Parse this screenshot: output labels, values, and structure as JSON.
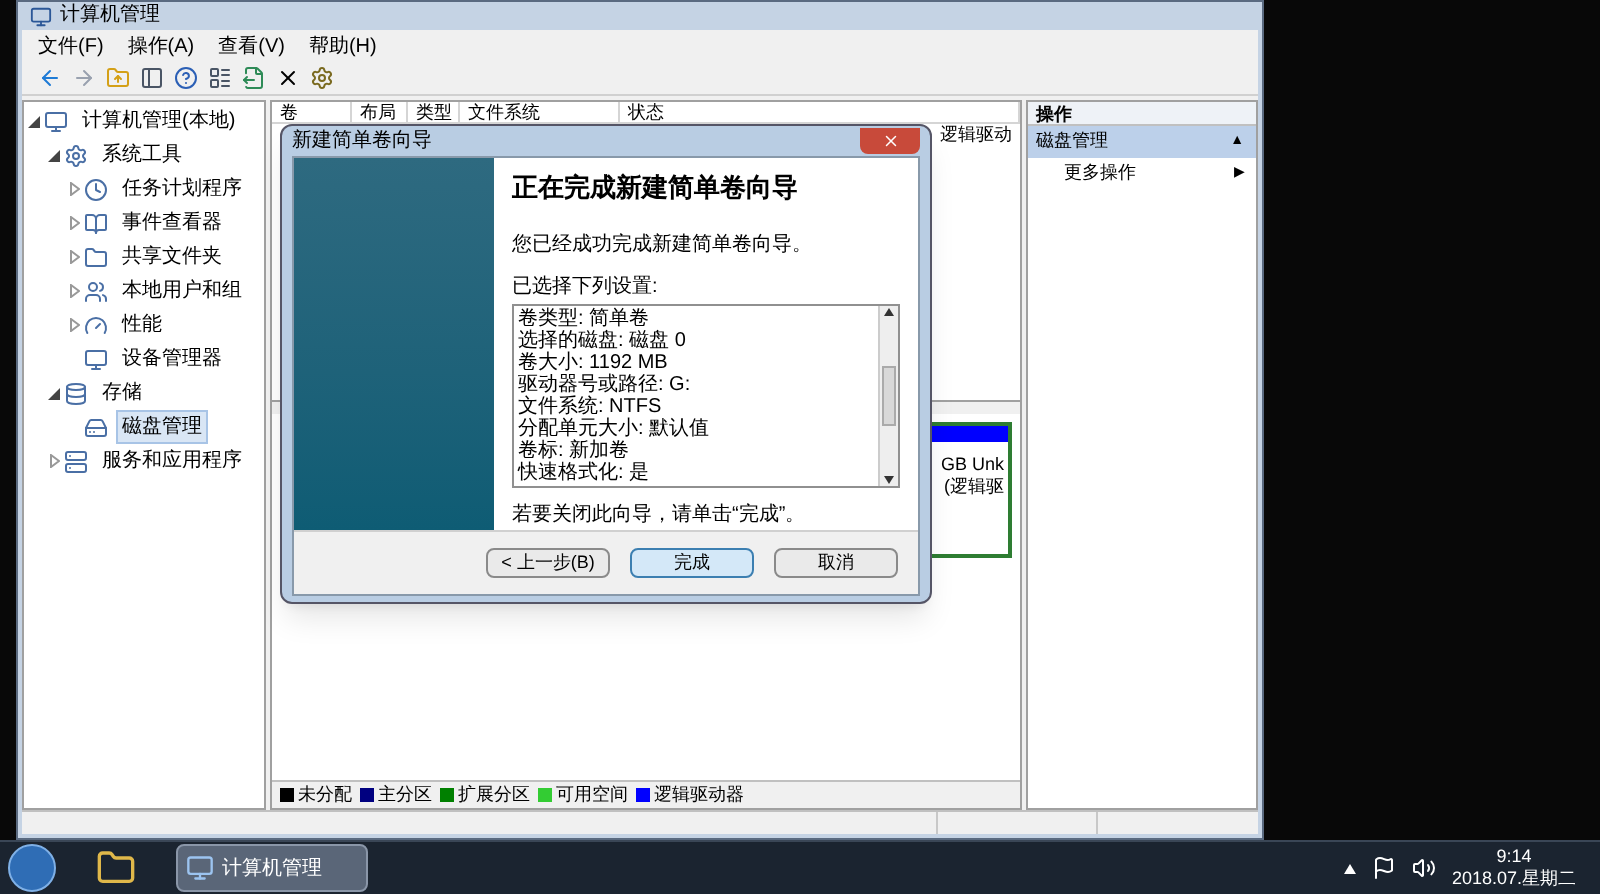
{
  "window": {
    "title": "计算机管理"
  },
  "menu": [
    "文件(F)",
    "操作(A)",
    "查看(V)",
    "帮助(H)"
  ],
  "tree": [
    {
      "label": "计算机管理(本地)",
      "selected": false,
      "expanded": true,
      "children": [
        {
          "label": "系统工具",
          "selected": false,
          "expanded": true,
          "children": [
            {
              "label": "任务计划程序",
              "selected": false,
              "expanded": false
            },
            {
              "label": "事件查看器",
              "selected": false,
              "expanded": false
            },
            {
              "label": "共享文件夹",
              "selected": false,
              "expanded": false
            },
            {
              "label": "本地用户和组",
              "selected": false,
              "expanded": false
            },
            {
              "label": "性能",
              "selected": false,
              "expanded": false
            },
            {
              "label": "设备管理器",
              "selected": false
            }
          ]
        },
        {
          "label": "存储",
          "selected": false,
          "expanded": true,
          "children": [
            {
              "label": "磁盘管理",
              "selected": true
            }
          ]
        },
        {
          "label": "服务和应用程序",
          "selected": false,
          "expanded": false
        }
      ]
    }
  ],
  "volume_table": {
    "columns": [
      "卷",
      "布局",
      "类型",
      "文件系统",
      "状态"
    ],
    "rows": [
      {
        "status": "逻辑驱动"
      },
      {},
      {},
      {}
    ]
  },
  "disk_map": {
    "lines": [
      "GB Unk",
      "(逻辑驱"
    ]
  },
  "legend": [
    {
      "label": "未分配",
      "color": "#000000"
    },
    {
      "label": "主分区",
      "color": "#000080"
    },
    {
      "label": "扩展分区",
      "color": "#008000"
    },
    {
      "label": "可用空间",
      "color": "#33cc33"
    },
    {
      "label": "逻辑驱动器",
      "color": "#0000ff"
    }
  ],
  "actions": {
    "header": "操作",
    "items": [
      {
        "label": "磁盘管理",
        "selected": true,
        "kind": "section",
        "glyph": "▲"
      },
      {
        "label": "更多操作",
        "selected": false,
        "kind": "submenu",
        "glyph": "▶"
      }
    ]
  },
  "dialog": {
    "title": "新建简单卷向导",
    "heading": "正在完成新建简单卷向导",
    "intro": "您已经成功完成新建简单卷向导。",
    "settings_label": "已选择下列设置:",
    "settings": [
      "卷类型: 简单卷",
      "选择的磁盘: 磁盘 0",
      "卷大小: 1192 MB",
      "驱动器号或路径: G:",
      "文件系统: NTFS",
      "分配单元大小: 默认值",
      "卷标: 新加卷",
      "快速格式化: 是"
    ],
    "closing": "若要关闭此向导，请单击“完成”。",
    "buttons": [
      {
        "label": "< 上一步(B)",
        "selected": false
      },
      {
        "label": "完成",
        "selected": true
      },
      {
        "label": "取消",
        "selected": false
      }
    ]
  },
  "taskbar": {
    "task": "计算机管理",
    "time": "9:14",
    "date": "2018.07.星期二"
  }
}
